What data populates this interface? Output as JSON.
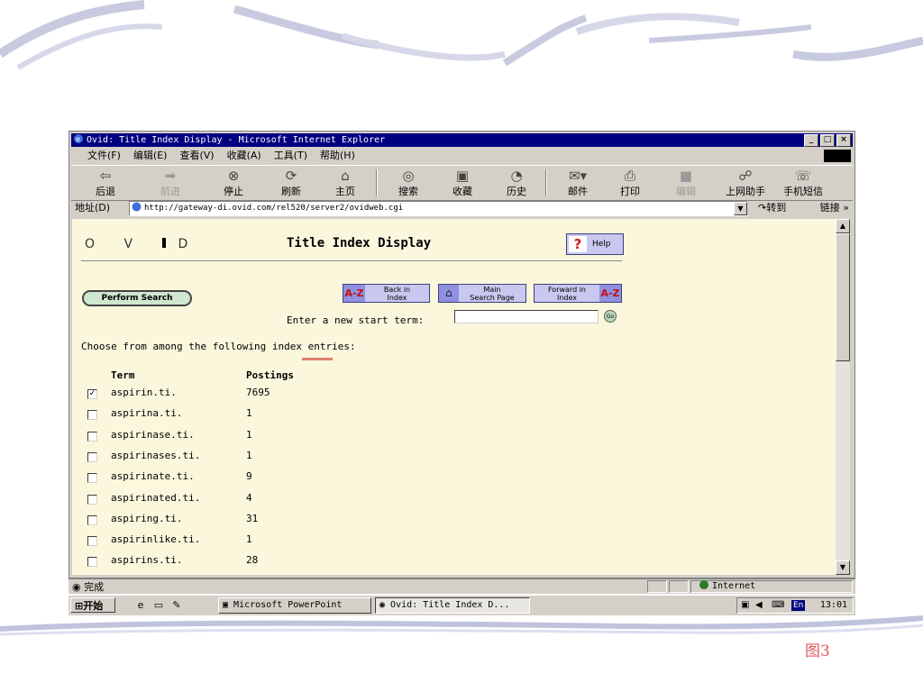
{
  "slide": {
    "figure_label": "图3"
  },
  "window": {
    "title": "Ovid: Title Index Display - Microsoft Internet Explorer",
    "controls": [
      "_",
      "□",
      "×"
    ]
  },
  "menu": [
    "文件(F)",
    "编辑(E)",
    "查看(V)",
    "收藏(A)",
    "工具(T)",
    "帮助(H)"
  ],
  "toolbar": {
    "back": "后退",
    "forward": "前进",
    "stop": "停止",
    "refresh": "刷新",
    "home": "主页",
    "search": "搜索",
    "favorites": "收藏",
    "history": "历史",
    "mail": "邮件",
    "print": "打印",
    "edit": "编辑",
    "assistant": "上网助手",
    "sms": "手机短信"
  },
  "address": {
    "label": "地址(D)",
    "url": "http://gateway-di.ovid.com/rel520/server2/ovidweb.cgi",
    "go": "转到",
    "links": "链接 »"
  },
  "page": {
    "logo": "O V D",
    "title": "Title Index Display",
    "help": "Help",
    "perform_search": "Perform Search",
    "back_in_index": [
      "Back in",
      "Index"
    ],
    "main_search": [
      "Main",
      "Search Page"
    ],
    "forward_in_index": [
      "Forward in",
      "Index"
    ],
    "az": "A-Z",
    "start_term_label": "Enter a new start term:",
    "start_term_value": "",
    "go": "Go",
    "choose_text": "Choose from among the following index entries:",
    "col_term": "Term",
    "col_postings": "Postings",
    "rows": [
      {
        "term": "aspirin.ti.",
        "postings": "7695",
        "checked": true
      },
      {
        "term": "aspirina.ti.",
        "postings": "1",
        "checked": false
      },
      {
        "term": "aspirinase.ti.",
        "postings": "1",
        "checked": false
      },
      {
        "term": "aspirinases.ti.",
        "postings": "1",
        "checked": false
      },
      {
        "term": "aspirinate.ti.",
        "postings": "9",
        "checked": false
      },
      {
        "term": "aspirinated.ti.",
        "postings": "4",
        "checked": false
      },
      {
        "term": "aspiring.ti.",
        "postings": "31",
        "checked": false
      },
      {
        "term": "aspirinlike.ti.",
        "postings": "1",
        "checked": false
      },
      {
        "term": "aspirins.ti.",
        "postings": "28",
        "checked": false
      }
    ]
  },
  "status": {
    "text": "完成",
    "zone": "Internet"
  },
  "taskbar": {
    "start": "开始",
    "tasks": [
      "Microsoft PowerPoint",
      "Ovid: Title Index D..."
    ],
    "lang": "En",
    "clock": "13:01"
  }
}
